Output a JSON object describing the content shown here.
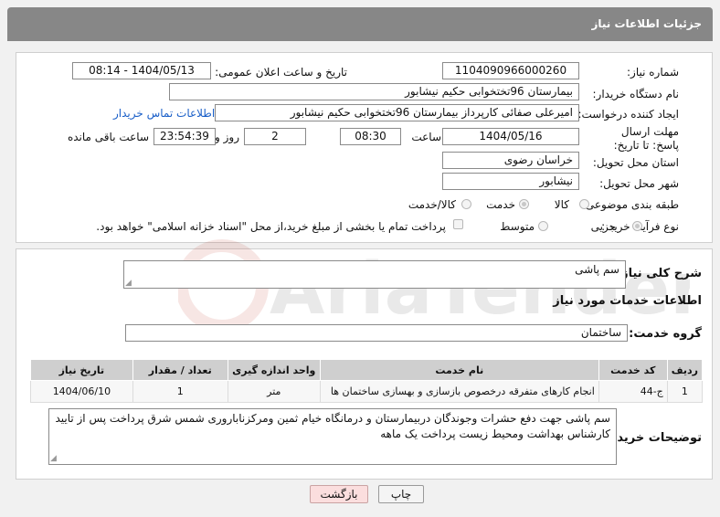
{
  "header": {
    "title": "جزئیات اطلاعات نیاز"
  },
  "labels": {
    "need_number": "شماره نیاز:",
    "announce_datetime": "تاریخ و ساعت اعلان عمومی:",
    "buyer_org": "نام دستگاه خریدار:",
    "requester": "ایجاد کننده درخواست:",
    "contact_link": "اطلاعات تماس خریدار",
    "deadline": "مهلت ارسال پاسخ: تا تاریخ:",
    "time_word": "ساعت",
    "day_word": "روز و",
    "remaining": "ساعت باقی مانده",
    "province": "استان محل تحویل:",
    "city": "شهر محل تحویل:",
    "category": "طبقه بندی موضوعی:",
    "purchase_type": "نوع فرآیند خرید :",
    "general_desc": "شرح کلی نیاز:",
    "services_info": "اطلاعات خدمات مورد نیاز",
    "service_group": "گروه خدمت:",
    "buyer_notes": "توضیحات خریدار:"
  },
  "values": {
    "need_number": "1104090966000260",
    "announce_datetime": "1404/05/13 - 08:14",
    "buyer_org": "بیمارستان 96تختخوابی حکیم نیشابور",
    "requester": "امیرعلی صفائی کارپرداز بیمارستان 96تختخوابی حکیم نیشابور",
    "deadline_date": "1404/05/16",
    "deadline_time": "08:30",
    "days": "2",
    "remaining_time": "23:54:39",
    "province": "خراسان رضوی",
    "city": "نیشابور",
    "general_desc": "سم پاشی",
    "service_group": "ساختمان",
    "buyer_notes": "سم پاشی جهت دفع حشرات وجوندگان دربیمارستان و درمانگاه خیام ثمین ومرکزناباروری شمس شرق پرداخت پس از تایید کارشناس بهداشت ومحیط زیست پرداخت یک ماهه"
  },
  "category_options": {
    "goods": "کالا",
    "service": "خدمت",
    "goods_service": "کالا/خدمت",
    "selected": "service"
  },
  "purchase_options": {
    "partial": "جزیی",
    "medium": "متوسط",
    "selected": "partial"
  },
  "treasury_note": "پرداخت تمام یا بخشی از مبلغ خرید،از محل \"اسناد خزانه اسلامی\" خواهد بود.",
  "table": {
    "headers": [
      "ردیف",
      "کد خدمت",
      "نام خدمت",
      "واحد اندازه گیری",
      "تعداد / مقدار",
      "تاریخ نیاز"
    ],
    "rows": [
      [
        "1",
        "ج-44",
        "انجام کارهای متفرقه درخصوص بازسازی و بهسازی ساختمان ها",
        "متر",
        "1",
        "1404/06/10"
      ]
    ]
  },
  "buttons": {
    "print": "چاپ",
    "back": "بازگشت"
  },
  "watermark": "AriaTender.neT"
}
